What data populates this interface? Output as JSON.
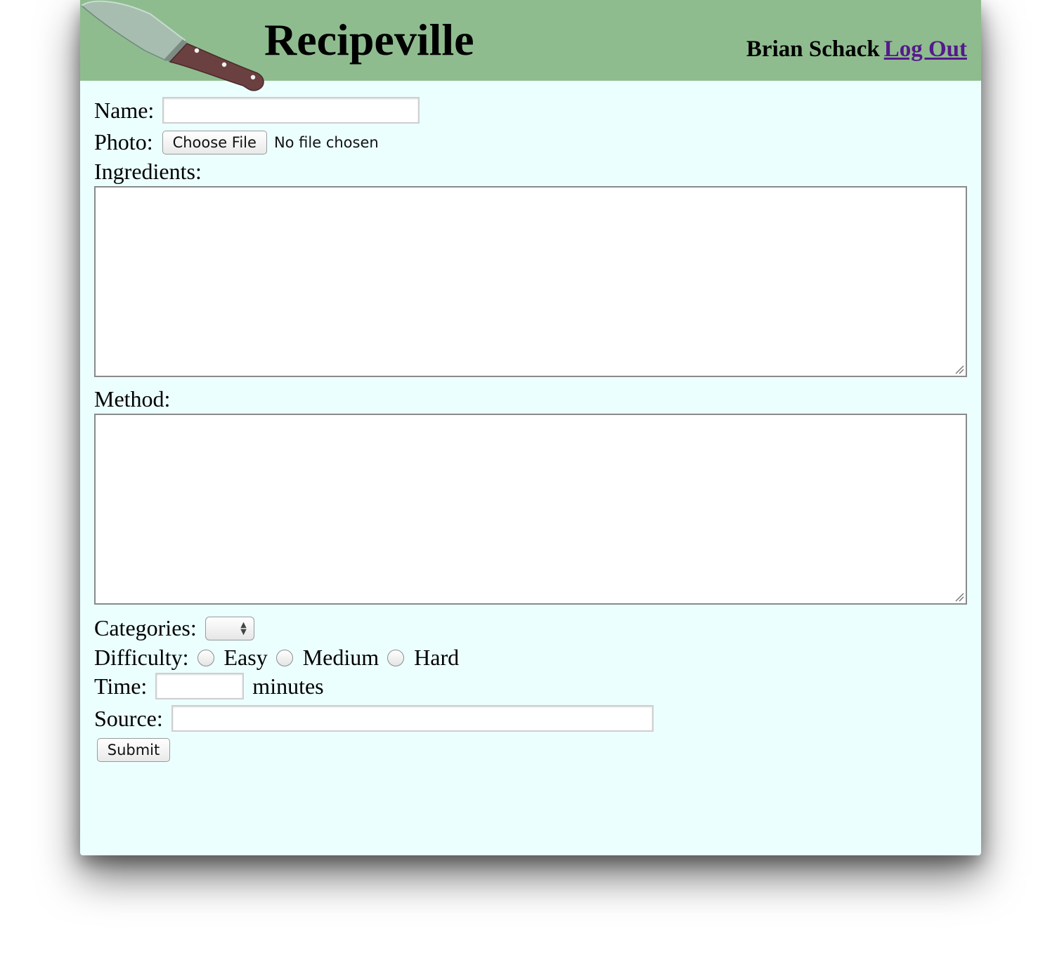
{
  "header": {
    "site_title": "Recipeville",
    "user_name": "Brian Schack",
    "logout_label": "Log Out"
  },
  "form": {
    "name_label": "Name:",
    "name_value": "",
    "photo_label": "Photo:",
    "choose_file_label": "Choose File",
    "file_status": "No file chosen",
    "ingredients_label": "Ingredients:",
    "ingredients_value": "",
    "method_label": "Method:",
    "method_value": "",
    "categories_label": "Categories:",
    "categories_selected": "",
    "difficulty_label": "Difficulty:",
    "difficulty_options": [
      "Easy",
      "Medium",
      "Hard"
    ],
    "time_label": "Time:",
    "time_value": "",
    "time_unit": "minutes",
    "source_label": "Source:",
    "source_value": "",
    "submit_label": "Submit"
  },
  "colors": {
    "header_bg": "#8fbc8f",
    "page_bg": "#ecffff",
    "link": "#551a8b"
  },
  "icons": [
    "knife-logo-icon",
    "resize-grip-icon",
    "select-arrows-icon"
  ]
}
